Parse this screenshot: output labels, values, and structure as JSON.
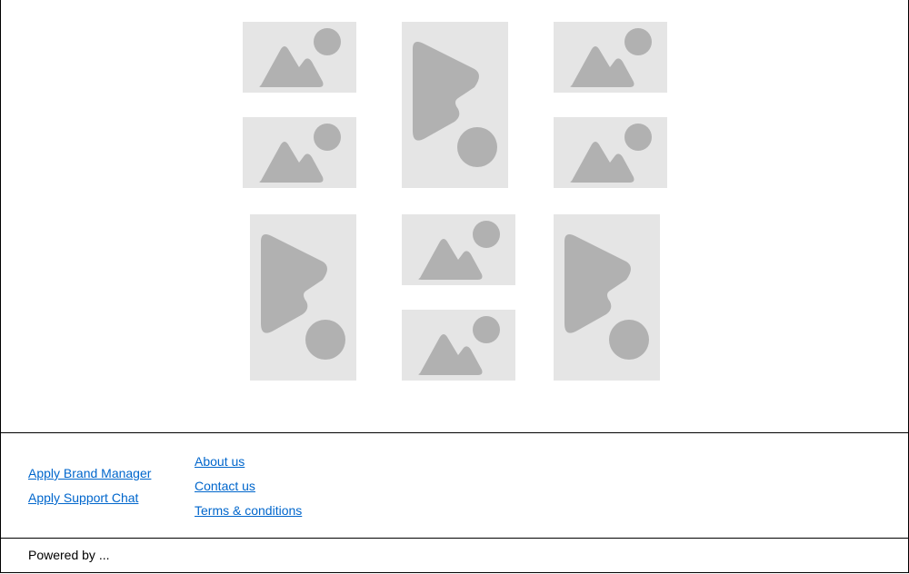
{
  "gallery": {
    "items": [
      {
        "kind": "image",
        "icon": "image-placeholder-icon"
      },
      {
        "kind": "video",
        "icon": "video-placeholder-icon"
      },
      {
        "kind": "image",
        "icon": "image-placeholder-icon"
      },
      {
        "kind": "image",
        "icon": "image-placeholder-icon"
      },
      {
        "kind": "image",
        "icon": "image-placeholder-icon"
      },
      {
        "kind": "video",
        "icon": "video-placeholder-icon"
      },
      {
        "kind": "image",
        "icon": "image-placeholder-icon"
      },
      {
        "kind": "video",
        "icon": "video-placeholder-icon"
      },
      {
        "kind": "image",
        "icon": "image-placeholder-icon"
      }
    ],
    "placeholder_bg": "#e5e5e5",
    "placeholder_fg": "#b1b1b1"
  },
  "footer": {
    "col1": [
      {
        "label": "Apply Brand Manager"
      },
      {
        "label": "Apply Support Chat"
      }
    ],
    "col2": [
      {
        "label": "About us"
      },
      {
        "label": "Contact us"
      },
      {
        "label": "Terms & conditions"
      }
    ],
    "link_color": "#0066cc"
  },
  "bottom_bar": {
    "powered_by": "Powered by ..."
  }
}
